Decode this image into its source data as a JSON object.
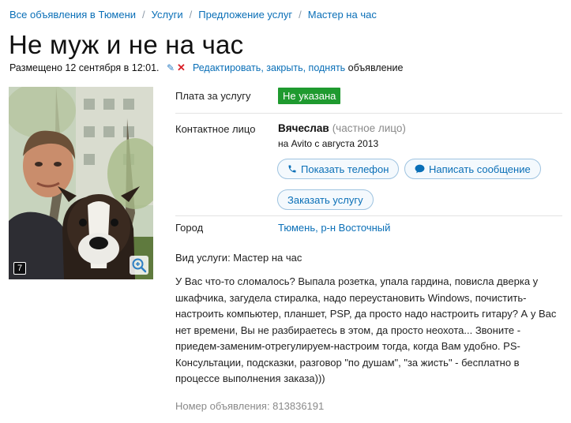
{
  "breadcrumb": {
    "items": [
      "Все объявления в Тюмени",
      "Услуги",
      "Предложение услуг",
      "Мастер на час"
    ],
    "separator": "/"
  },
  "title": "Не муж и не на час",
  "meta": {
    "posted": "Размещено 12 сентября в 12:01.",
    "edit": "Редактировать",
    "comma1": ", ",
    "close": "закрыть",
    "comma2": ", ",
    "raise": "поднять",
    "suffix": " объявление"
  },
  "photo": {
    "count": "7"
  },
  "price": {
    "label": "Плата за услугу",
    "value": "Не указана",
    "color": "#1f9a2f"
  },
  "contact": {
    "label": "Контактное лицо",
    "name": "Вячеслав",
    "type": "(частное лицо)",
    "since": "на Avito с августа 2013",
    "show_phone": "Показать телефон",
    "write_message": "Написать сообщение",
    "order_service": "Заказать услугу"
  },
  "city": {
    "label": "Город",
    "value": "Тюмень, р-н Восточный"
  },
  "service_type": "Вид услуги: Мастер на час",
  "description": "У Вас что-то сломалось? Выпала розетка, упала гардина, повисла дверка у шкафчика, загудела стиралка, надо переустановить Windows, почистить-настроить компьютер, планшет, PSP, да просто надо настроить гитару? А у Вас нет времени, Вы не разбираетесь в этом, да просто неохота... Звоните - приедем-заменим-отрегулируем-настроим тогда, когда Вам удобно. PS- Консультации, подсказки, разговор \"по душам\", \"за жисть\" - бесплатно в процессе выполнения заказа)))",
  "ad_number": "Номер объявления: 813836191",
  "icons": {
    "edit": "pencil-icon",
    "delete": "close-icon",
    "phone": "phone-icon",
    "message": "chat-bubble-icon",
    "zoom": "magnifier-icon"
  },
  "colors": {
    "link": "#0a6fb7",
    "delete": "#d81f26"
  }
}
